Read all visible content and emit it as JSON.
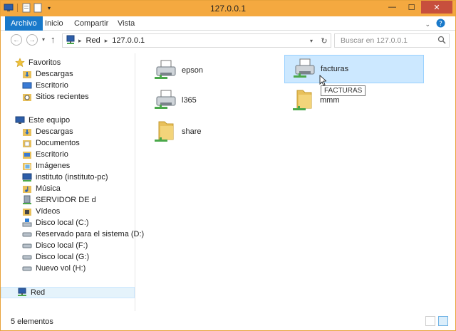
{
  "window": {
    "title": "127.0.0.1",
    "minimize": "—",
    "maximize": "☐",
    "close": "✕"
  },
  "ribbon": {
    "tabs": [
      "Archivo",
      "Inicio",
      "Compartir",
      "Vista"
    ]
  },
  "address": {
    "crumbs": [
      "Red",
      "127.0.0.1"
    ],
    "search_placeholder": "Buscar en 127.0.0.1"
  },
  "nav": {
    "favorites_label": "Favoritos",
    "favorites": [
      "Descargas",
      "Escritorio",
      "Sitios recientes"
    ],
    "computer_label": "Este equipo",
    "computer": [
      "Descargas",
      "Documentos",
      "Escritorio",
      "Imágenes",
      "instituto (instituto-pc)",
      "Música",
      "SERVIDOR DE d",
      "Vídeos",
      "Disco local (C:)",
      "Reservado para el sistema (D:)",
      "Disco local (F:)",
      "Disco local (G:)",
      "Nuevo vol (H:)"
    ],
    "network_label": "Red"
  },
  "items": [
    {
      "name": "epson",
      "type": "printer"
    },
    {
      "name": "facturas",
      "type": "printer"
    },
    {
      "name": "l365",
      "type": "printer"
    },
    {
      "name": "mmm",
      "type": "folder"
    },
    {
      "name": "share",
      "type": "folder"
    }
  ],
  "tooltip": "FACTURAS",
  "status": {
    "count": "5 elementos"
  },
  "colors": {
    "titlebar": "#f4a940",
    "file_tab": "#1979ca",
    "selection": "#cce8ff",
    "close": "#c74f3d"
  }
}
